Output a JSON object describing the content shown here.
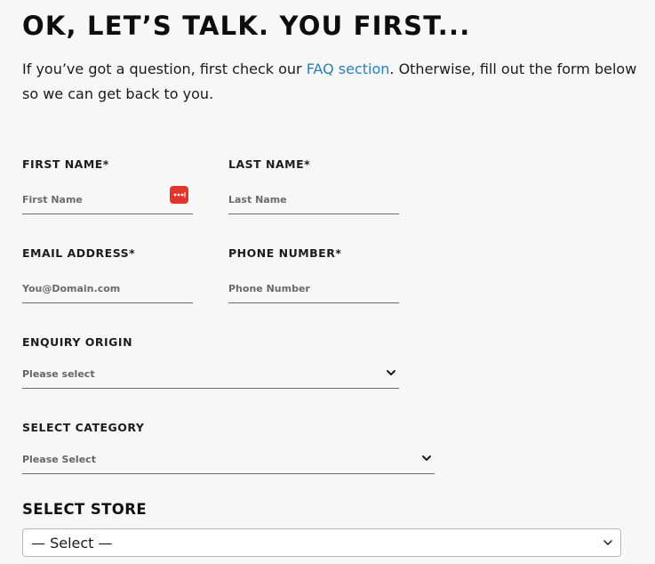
{
  "heading": "OK, LET’S TALK. YOU FIRST...",
  "intro": {
    "before_link": "If you’ve got a question, first check our ",
    "link_text": "FAQ section",
    "after_link": ". Otherwise, fill out the form below so we can get back to you."
  },
  "form": {
    "first_name": {
      "label": "FIRST NAME*",
      "placeholder": "First Name",
      "value": ""
    },
    "last_name": {
      "label": "LAST NAME*",
      "placeholder": "Last Name",
      "value": ""
    },
    "email": {
      "label": "EMAIL ADDRESS*",
      "placeholder": "You@Domain.com",
      "value": ""
    },
    "phone": {
      "label": "PHONE NUMBER*",
      "placeholder": "Phone Number",
      "value": ""
    },
    "enquiry_origin": {
      "label": "ENQUIRY ORIGIN",
      "selected": "Please select"
    },
    "category": {
      "label": "SELECT CATEGORY",
      "selected": "Please Select"
    },
    "store": {
      "label": "SELECT STORE",
      "selected": "— Select —"
    }
  },
  "colors": {
    "accent_underline": "#b6dc14",
    "link": "#2a7fb5",
    "password_manager_icon": "#e2362d"
  },
  "icons": {
    "password_manager": "password-manager-icon",
    "dropdown": "chevron-down-icon"
  }
}
